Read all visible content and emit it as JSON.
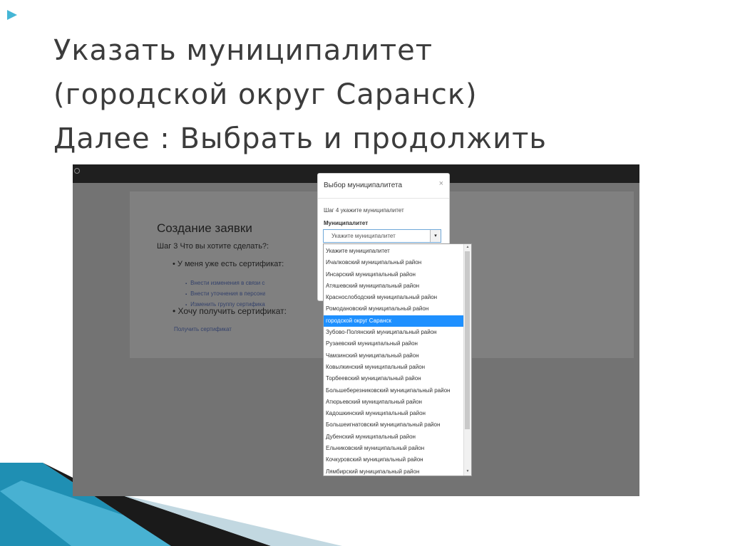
{
  "slide": {
    "title_lines": [
      "Указать муниципалитет",
      "(городской округ Саранск)",
      "Далее : Выбрать и продолжить"
    ]
  },
  "page": {
    "title": "Создание заявки",
    "step3": "Шаг 3 Что вы хотите сделать?:",
    "have_cert": "У меня уже есть сертификат:",
    "cert_links": [
      "Внести изменения в связи со сменой муниципалитета",
      "Внести уточнения в персональные данные",
      "Изменить группу сертификата"
    ],
    "want_cert": "Хочу получить сертификат:",
    "get_cert_link": "Получить сертификат"
  },
  "modal": {
    "title": "Выбор муниципалитета",
    "close_symbol": "×",
    "step4": "Шаг 4 укажите муниципалитет",
    "field_label": "Муниципалитет",
    "select_value": "Укажите муниципалитет",
    "select_arrow": "▾",
    "options": [
      "Укажите муниципалитет",
      "Ичалковский муниципальный район",
      "Инсарский муниципальный район",
      "Атяшевский муниципальный район",
      "Краснослободский муниципальный район",
      "Ромодановский муниципальный район",
      "городской округ Саранск",
      "Зубово-Полянский муниципальный район",
      "Рузаевский муниципальный район",
      "Чамзинский муниципальный район",
      "Ковылкинский муниципальный район",
      "Торбеевский муниципальный район",
      "Большеберезниковский муниципальный район",
      "Атюрьевский муниципальный район",
      "Кадошкинский муниципальный район",
      "Большеигнатовский муниципальный район",
      "Дубенский муниципальный район",
      "Ельниковский муниципальный район",
      "Кочкуровский муниципальный район",
      "Лямбирский муниципальный район"
    ],
    "selected_option": "городской округ Саранск"
  },
  "colors": {
    "selected": "#1e90ff",
    "overlay": "#737373",
    "accent_teal": "#1a8fb0"
  }
}
